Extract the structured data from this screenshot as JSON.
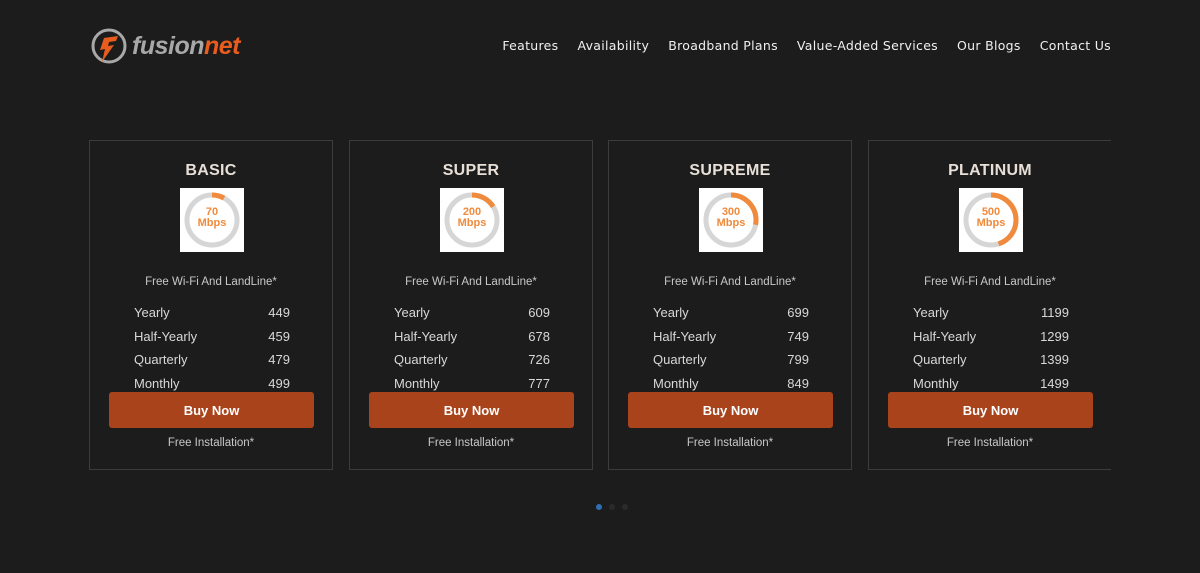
{
  "brand": {
    "part1": "fusion",
    "part2": "net",
    "accent": "#e85d1e"
  },
  "nav": [
    {
      "label": "Features"
    },
    {
      "label": "Availability"
    },
    {
      "label": "Broadband Plans"
    },
    {
      "label": "Value-Added Services"
    },
    {
      "label": "Our Blogs"
    },
    {
      "label": "Contact Us"
    }
  ],
  "plans": [
    {
      "name": "BASIC",
      "speed": "70",
      "unit": "Mbps",
      "gauge_fraction": 0.08,
      "feature": "Free Wi-Fi And LandLine*",
      "prices": [
        {
          "period": "Yearly",
          "price": "449"
        },
        {
          "period": "Half-Yearly",
          "price": "459"
        },
        {
          "period": "Quarterly",
          "price": "479"
        },
        {
          "period": "Monthly",
          "price": "499"
        }
      ],
      "cta": "Buy Now",
      "install": "Free Installation*"
    },
    {
      "name": "SUPER",
      "speed": "200",
      "unit": "Mbps",
      "gauge_fraction": 0.16,
      "feature": "Free Wi-Fi And LandLine*",
      "prices": [
        {
          "period": "Yearly",
          "price": "609"
        },
        {
          "period": "Half-Yearly",
          "price": "678"
        },
        {
          "period": "Quarterly",
          "price": "726"
        },
        {
          "period": "Monthly",
          "price": "777"
        }
      ],
      "cta": "Buy Now",
      "install": "Free Installation*"
    },
    {
      "name": "SUPREME",
      "speed": "300",
      "unit": "Mbps",
      "gauge_fraction": 0.28,
      "feature": "Free Wi-Fi And LandLine*",
      "prices": [
        {
          "period": "Yearly",
          "price": "699"
        },
        {
          "period": "Half-Yearly",
          "price": "749"
        },
        {
          "period": "Quarterly",
          "price": "799"
        },
        {
          "period": "Monthly",
          "price": "849"
        }
      ],
      "cta": "Buy Now",
      "install": "Free Installation*"
    },
    {
      "name": "PLATINUM",
      "speed": "500",
      "unit": "Mbps",
      "gauge_fraction": 0.45,
      "feature": "Free Wi-Fi And LandLine*",
      "prices": [
        {
          "period": "Yearly",
          "price": "1199"
        },
        {
          "period": "Half-Yearly",
          "price": "1299"
        },
        {
          "period": "Quarterly",
          "price": "1399"
        },
        {
          "period": "Monthly",
          "price": "1499"
        }
      ],
      "cta": "Buy Now",
      "install": "Free Installation*"
    }
  ],
  "colors": {
    "background": "#1c1c1c",
    "button": "#a9431b",
    "gauge_fill": "#f08a3c",
    "gauge_track": "#d6d6d6",
    "active_dot": "#2f6db5"
  },
  "carousel": {
    "pages": 3,
    "active": 0
  }
}
